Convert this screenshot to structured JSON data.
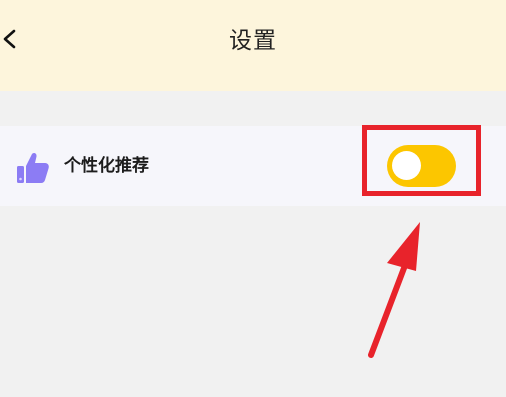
{
  "header": {
    "title": "设置",
    "back_icon": "chevron-left-icon",
    "background": "#fdf5dc"
  },
  "settings": {
    "personalized_recommendation": {
      "label": "个性化推荐",
      "icon": "thumbs-up-icon",
      "icon_color": "#8c7cf4",
      "enabled": true
    }
  },
  "toggle": {
    "on_color": "#fcc600",
    "knob_color": "#ffffff"
  },
  "annotation": {
    "highlight_color": "#e8232b"
  }
}
